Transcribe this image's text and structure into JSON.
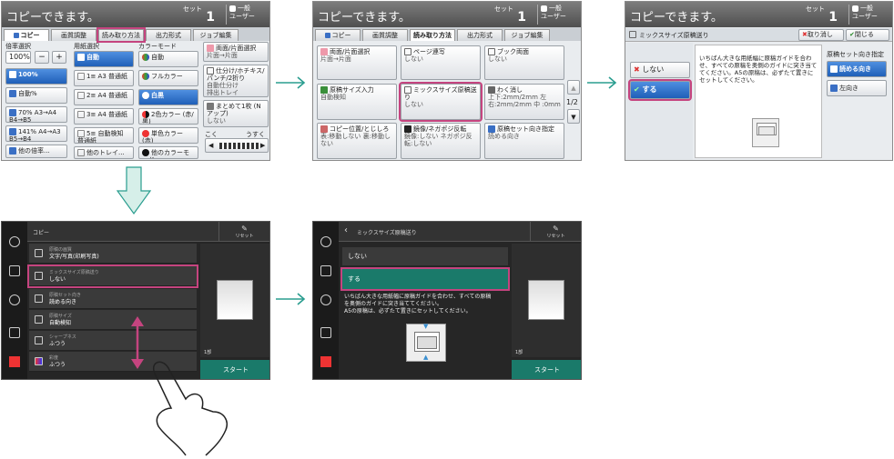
{
  "colors": {
    "highlight": "#c5447f",
    "arrow": "#2a9d8f",
    "selected": "#1f5fb8",
    "start": "#1a7a6a"
  },
  "p1": {
    "title": "コピーできます。",
    "set_label": "セット",
    "set_count": "1",
    "user": [
      "一般",
      "ユーザー"
    ],
    "tabs": [
      "コピー",
      "画質調整",
      "読み取り方法",
      "出力形式",
      "ジョブ編集"
    ],
    "col1_label": "倍率選択",
    "zoom_value": "100",
    "zoom_unit": "%",
    "minus": "−",
    "plus": "+",
    "ratio_buttons": [
      "100%",
      "自動%",
      "70% A3→A4 B4→B5",
      "141% A4→A3 B5→B4",
      "他の倍率..."
    ],
    "col2_label": "用紙選択",
    "paper_buttons": [
      "自動",
      "1≡ A3 普通紙",
      "2≡ A4 普通紙",
      "3≡ A4 普通紙",
      "5≡ 自動検知 普通紙",
      "他のトレイ..."
    ],
    "col3_label": "カラーモード",
    "color_buttons": [
      "自動",
      "フルカラー",
      "白黒",
      "2色カラー (赤/黒)",
      "単色カラー (赤)",
      "他のカラーモード..."
    ],
    "duplex_title": "両面/片面選択",
    "duplex_sub": "片面→片面",
    "sort_title": "仕分け/ホチキス/パンチ/2折り",
    "sort_sub1": "自動仕分け",
    "sort_sub2": "排出トレイ",
    "nup_title": "まとめて1枚 (Nアップ)",
    "nup_sub": "しない",
    "density_dark": "こく",
    "density_light": "うすく"
  },
  "p2": {
    "title": "コピーできます。",
    "set_label": "セット",
    "set_count": "1",
    "user": [
      "一般",
      "ユーザー"
    ],
    "tabs": [
      "コピー",
      "画質調整",
      "読み取り方法",
      "出力形式",
      "ジョブ編集"
    ],
    "buttons": [
      {
        "t": "両面/片面選択",
        "s": "片面→片面"
      },
      {
        "t": "ページ連写",
        "s": "しない"
      },
      {
        "t": "ブック両面",
        "s": "しない"
      },
      {
        "t": "原稿サイズ入力",
        "s": "自動検知"
      },
      {
        "t": "ミックスサイズ原稿送り",
        "s": "しない"
      },
      {
        "t": "わく消し",
        "s": "上下:2mm/2mm 左右:2mm/2mm 中 :0mm"
      },
      {
        "t": "コピー位置/とじしろ",
        "s": "表:移動しない 裏:移動しない"
      },
      {
        "t": "鏡像/ネガポジ反転",
        "s": "鏡像:しない ネガポジ反転:しない"
      },
      {
        "t": "原稿セット向き指定",
        "s": "読める向き"
      }
    ],
    "page": "1/2",
    "up": "▲",
    "down": "▼"
  },
  "p3": {
    "title": "コピーできます。",
    "set_label": "セット",
    "set_count": "1",
    "user": [
      "一般",
      "ユーザー"
    ],
    "dialog_title": "ミックスサイズ原稿送り",
    "cancel": "取り消し",
    "close": "閉じる",
    "opt_off": "しない",
    "opt_on": "する",
    "desc": "いちばん大きな用紙幅に原稿ガイドを合わせ、すべての原稿を奥側のガイドに突き当ててください。A5の原稿は、必ずたて置きにセットしてください。",
    "orient_label": "原稿セット向き指定",
    "orient_read": "読める向き",
    "orient_left": "左向き"
  },
  "p4": {
    "header": "コピー",
    "reset": "リセット",
    "rows": [
      {
        "t1": "原稿の画質",
        "t2": "文字/写真(印刷写真)"
      },
      {
        "t1": "ミックスサイズ原稿送り",
        "t2": "しない"
      },
      {
        "t1": "原稿セット向き",
        "t2": "読める向き"
      },
      {
        "t1": "原稿サイズ",
        "t2": "自動検知"
      },
      {
        "t1": "シャープネス",
        "t2": "ふつう"
      },
      {
        "t1": "彩度",
        "t2": "ふつう"
      }
    ],
    "count": "1部",
    "start": "スタート"
  },
  "p5": {
    "header": "ミックスサイズ原稿送り",
    "reset": "リセット",
    "opt_off": "しない",
    "opt_on": "する",
    "desc1": "いちばん大きな用紙幅に原稿ガイドを合わせ、すべての原稿",
    "desc2": "を奥側のガイドに突き当ててください。",
    "desc3": "A5の原稿は、必ずたて置きにセットしてください。",
    "count": "1部",
    "start": "スタート"
  }
}
